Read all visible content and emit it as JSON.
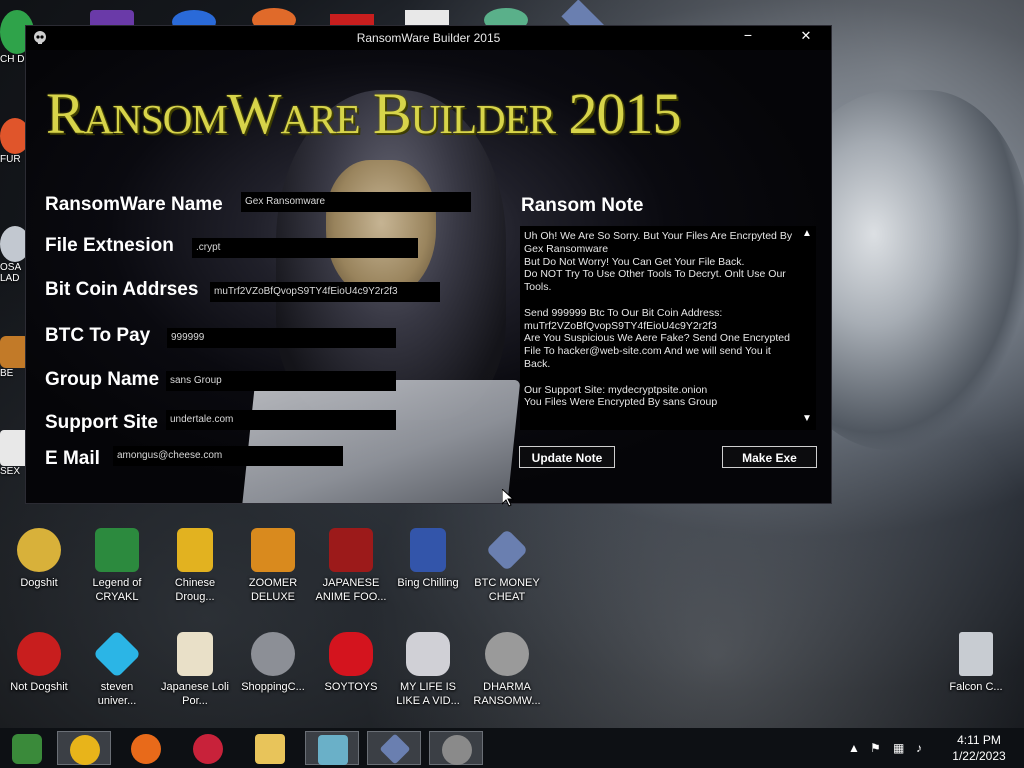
{
  "window": {
    "title": "RansomWare Builder 2015",
    "min_glyph": "−",
    "close_glyph": "✕",
    "logo": "RansomWare Builder 2015"
  },
  "form": {
    "fields": [
      {
        "label": "RansomWare Name",
        "value": "Gex Ransomware"
      },
      {
        "label": "File Extnesion",
        "value": ".crypt"
      },
      {
        "label": "Bit Coin Addrses",
        "value": "muTrf2VZoBfQvopS9TY4fEioU4c9Y2r2f3"
      },
      {
        "label": "BTC To Pay",
        "value": "999999"
      },
      {
        "label": "Group Name",
        "value": "sans Group"
      },
      {
        "label": "Support Site",
        "value": "undertale.com"
      },
      {
        "label": "E Mail",
        "value": "amongus@cheese.com"
      }
    ]
  },
  "note": {
    "title": "Ransom Note",
    "text": "Uh Oh! We Are So Sorry. But Your Files Are Encrpyted By Gex Ransomware\nBut Do Not Worry! You Can Get Your File Back.\nDo NOT Try To Use Other Tools To Decryt. Onlt Use Our Tools.\n\nSend 999999 Btc To Our Bit Coin Address:\nmuTrf2VZoBfQvopS9TY4fEioU4c9Y2r2f3\nAre You Suspicious We Aere Fake? Send One Encrypted File To hacker@web-site.com And we will send You it Back.\n\nOur Support Site: mydecryptpsite.onion\nYou Files Were Encrypted By sans Group"
  },
  "buttons": {
    "update": "Update Note",
    "make": "Make Exe"
  },
  "desktop": {
    "row1": [
      {
        "label": "Dogshit",
        "icon": "cpp-dogshit-icon",
        "color": "#d8b13a"
      },
      {
        "label": "Legend of CRYAKL",
        "icon": "pixel-hero-icon",
        "color": "#2c8a3e"
      },
      {
        "label": "Chinese Droug...",
        "icon": "mahjong-tile-icon",
        "color": "#e2b220"
      },
      {
        "label": "ZOOMER DELUXE",
        "icon": "zuma-icon",
        "color": "#d98a1e"
      },
      {
        "label": "JAPANESE ANIME FOO...",
        "icon": "flash-icon",
        "color": "#9c1a1a"
      },
      {
        "label": "Bing Chilling",
        "icon": "box-icon",
        "color": "#3355aa"
      },
      {
        "label": "BTC MONEY CHEAT",
        "icon": "diamond-icon",
        "color": "#6a7fb0"
      }
    ],
    "row2": [
      {
        "label": "Not Dogshit",
        "icon": "dev-cpp-icon",
        "color": "#c81e1e"
      },
      {
        "label": "steven univer...",
        "icon": "gem-icon",
        "color": "#2bb5e6"
      },
      {
        "label": "Japanese Loli Por...",
        "icon": "torii-tile-icon",
        "color": "#e9e0c8"
      },
      {
        "label": "ShoppingC...",
        "icon": "flash-player-icon",
        "color": "#8c8f96"
      },
      {
        "label": "SOYTOYS",
        "icon": "s-logo-icon",
        "color": "#d4141e"
      },
      {
        "label": "MY LIFE IS LIKE A VID...",
        "icon": "gamepad-icon",
        "color": "#d0d0d6"
      },
      {
        "label": "DHARMA RANSOMW...",
        "icon": "skull-icon",
        "color": "#9a9a9a"
      }
    ],
    "recycle": "Falcon C...",
    "left_partial": [
      "CH D",
      "FUR",
      "OSA LAD",
      "BE",
      "SEX"
    ]
  },
  "taskbar": {
    "time": "4:11 PM",
    "date": "1/22/2023",
    "apps": [
      {
        "name": "chrome-alt-icon",
        "color": "#3a8a3a"
      },
      {
        "name": "chrome-icon",
        "color": "#e8b41a"
      },
      {
        "name": "firefox-icon",
        "color": "#e86a1a"
      },
      {
        "name": "osu-icon",
        "color": "#c8223a"
      },
      {
        "name": "file-explorer-icon",
        "color": "#e8c45a"
      },
      {
        "name": "paint-icon",
        "color": "#6ab0c8"
      },
      {
        "name": "diamond-app-icon",
        "color": "#6a7fb0"
      },
      {
        "name": "skull-app-icon",
        "color": "#8a8a8a"
      }
    ]
  }
}
